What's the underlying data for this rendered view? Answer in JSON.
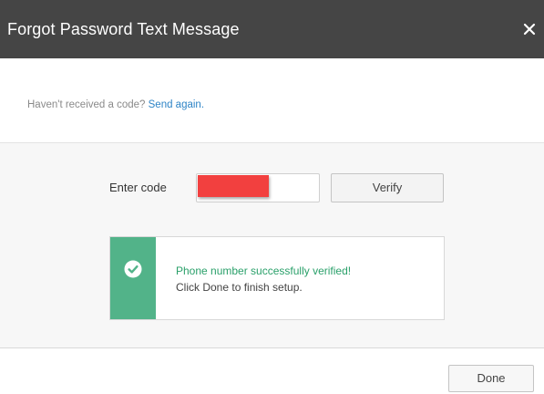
{
  "dialog": {
    "title": "Forgot Password Text Message",
    "close_icon": "close-icon"
  },
  "resend": {
    "prompt": "Haven't received a code?",
    "link": "Send again."
  },
  "code_entry": {
    "label": "Enter code",
    "value": "",
    "verify_label": "Verify"
  },
  "status": {
    "icon": "check-circle-icon",
    "title": "Phone number successfully verified!",
    "message": "Click Done to finish setup.",
    "accent_color": "#52b389"
  },
  "footer": {
    "done_label": "Done"
  },
  "colors": {
    "titlebar": "#454545",
    "link": "#2e84c6",
    "success_text": "#2aa06a"
  }
}
